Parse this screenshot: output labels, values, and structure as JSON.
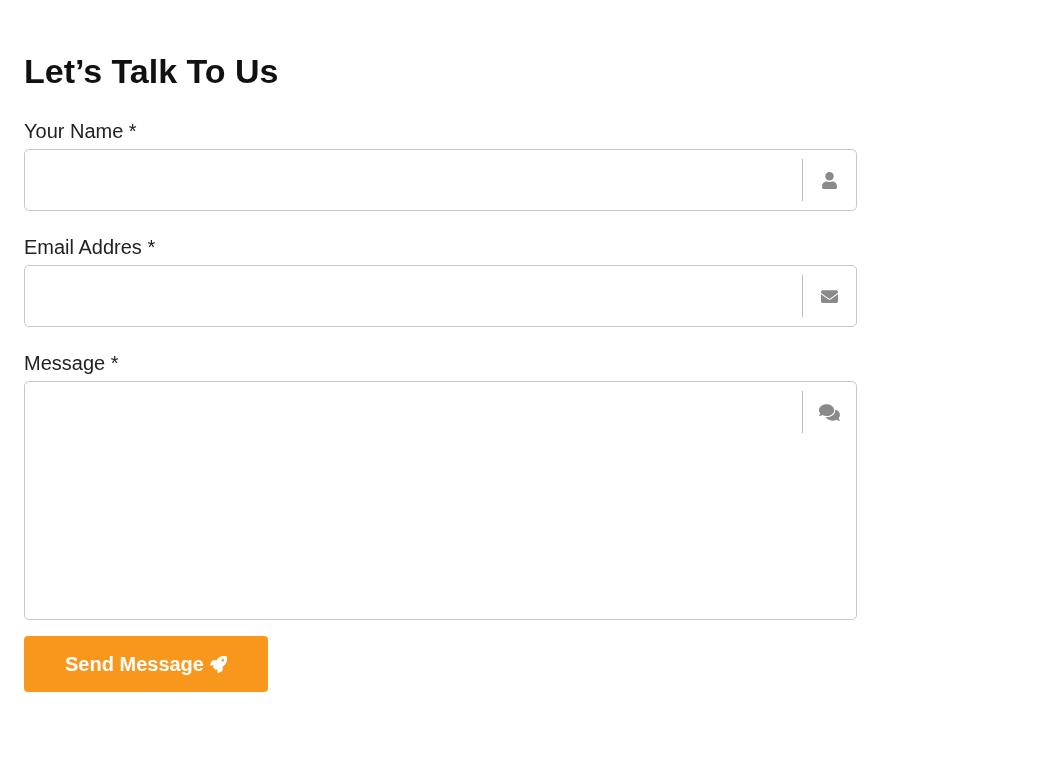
{
  "heading": "Let’s Talk To Us",
  "fields": [
    {
      "kind": "name",
      "label": "Your Name *"
    },
    {
      "kind": "email",
      "label": "Email Addres *"
    },
    {
      "kind": "message",
      "label": "Message *"
    }
  ],
  "submit": {
    "label": "Send Message"
  }
}
